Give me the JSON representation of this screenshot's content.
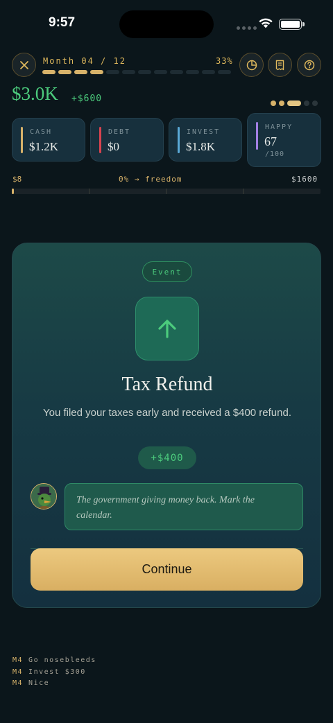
{
  "status_bar": {
    "time": "9:57"
  },
  "header": {
    "month_label": "Month 04 / 12",
    "progress_percent": "33%",
    "months_total": 12,
    "months_done": 4,
    "icons": {
      "close": "close-icon",
      "chart": "pie-chart-icon",
      "receipt": "receipt-icon",
      "help": "help-icon"
    }
  },
  "summary": {
    "net_worth": "$3.0K",
    "delta": "+$600",
    "page_dots": 5,
    "page_active": 2
  },
  "stats": [
    {
      "label": "CASH",
      "value": "$1.2K",
      "color": "#d7b26a"
    },
    {
      "label": "DEBT",
      "value": "$0",
      "color": "#d8434f"
    },
    {
      "label": "INVEST",
      "value": "$1.8K",
      "color": "#5aa9d6"
    },
    {
      "label": "HAPPY",
      "value": "67",
      "sub": "/100",
      "color": "#a27fe3"
    }
  ],
  "freedom": {
    "left": "$8",
    "middle": "0% → freedom",
    "right": "$1600",
    "fraction": 0.005
  },
  "event": {
    "tag": "Event",
    "icon": "arrow-up-icon",
    "title": "Tax Refund",
    "description": "You filed your taxes early and received a $400 refund.",
    "amount": "+$400",
    "quote": "The government giving money back. Mark the calendar.",
    "button": "Continue"
  },
  "log": [
    {
      "month": "M4",
      "text": "Go nosebleeds"
    },
    {
      "month": "M4",
      "text": "Invest $300"
    },
    {
      "month": "M4",
      "text": "Nice"
    }
  ]
}
